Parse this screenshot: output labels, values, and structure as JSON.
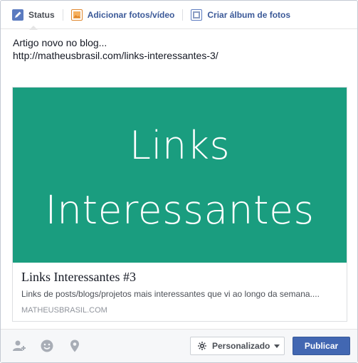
{
  "tabs": [
    {
      "label": "Status",
      "icon": "pencil-icon",
      "active": true
    },
    {
      "label": "Adicionar fotos/vídeo",
      "icon": "photo-icon"
    },
    {
      "label": "Criar álbum de fotos",
      "icon": "album-icon"
    }
  ],
  "post": {
    "line1": "Artigo novo no blog...",
    "line2": "http://matheusbrasil.com/links-interessantes-3/"
  },
  "link_preview": {
    "image_text_line1": "Links",
    "image_text_line2": "Interessantes",
    "image_bg_color": "#1a9d7f",
    "title": "Links Interessantes #3",
    "description": "Links de posts/blogs/projetos mais interessantes que vi ao longo da semana....",
    "domain": "MATHEUSBRASIL.COM"
  },
  "footer": {
    "icons": [
      "tag-friends-icon",
      "feeling-icon",
      "location-pin-icon"
    ],
    "privacy_label": "Personalizado",
    "publish_label": "Publicar"
  },
  "colors": {
    "link_blue": "#3b5998",
    "publish_blue": "#4267b2"
  }
}
